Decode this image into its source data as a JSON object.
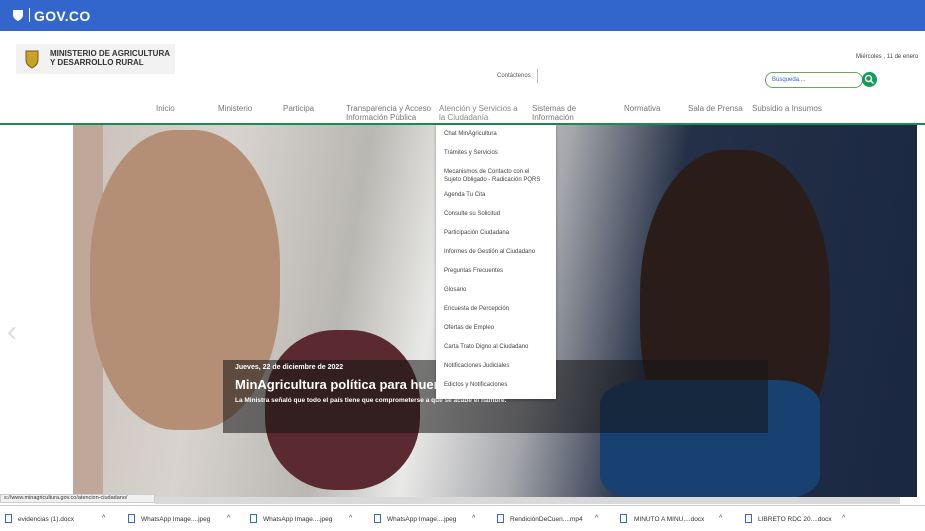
{
  "govbar": {
    "brand": "GOV.CO"
  },
  "header": {
    "ministry_line1": "MINISTERIO DE AGRICULTURA",
    "ministry_line2": "Y DESARROLLO RURAL",
    "date": "Miércoles , 11 de enero",
    "contact": "Contáctenos",
    "search_placeholder": "Búsqueda...."
  },
  "nav": [
    {
      "label": "Inicio"
    },
    {
      "label": "Ministerio"
    },
    {
      "label": "Participa"
    },
    {
      "label_1": "Transparencia y Acceso",
      "label_2": "Información Pública"
    },
    {
      "label_1": "Atención y Servicios a",
      "label_2": "la Ciudadanía"
    },
    {
      "label_1": "Sistemas de",
      "label_2": "Información"
    },
    {
      "label": "Normativa"
    },
    {
      "label": "Sala de Prensa"
    },
    {
      "label": "Subsidio a Insumos"
    }
  ],
  "dropdown": [
    "Chat MinAgricultura",
    "Trámites y Servicios",
    "Mecanismos de Contacto con el",
    "Sujeto Obligado - Radicación PQRS",
    "Agenda Tu Cita",
    "Consulte su Solicitud",
    "Participación Ciudadana",
    "Informes de Gestión al Ciudadano",
    "Preguntas Frecuentes",
    "Glosario",
    "Encuesta de Percepción",
    "Ofertas de Empleo",
    "Carta Trato Digno al Ciudadano",
    "Notificaciones Judiciales",
    "Edictos y Notificaciones"
  ],
  "caption": {
    "date": "Jueves, 22 de diciembre de 2022",
    "title": "MinAgricultura política para huert                              es comunitarios",
    "subtitle": "La Ministra señaló que todo el país tiene que comprometerse a que se acabe el hambre."
  },
  "status_url": "s://www.minagricultura.gov.co/atencion-ciudadano/",
  "downloads": [
    "evidencias (1).docx",
    "WhatsApp Image....jpeg",
    "WhatsApp Image....jpeg",
    "WhatsApp Image....jpeg",
    "RendiciónDeCuen....mp4",
    "MINUTO A MINU....docx",
    "LIBRETO RDC 20....docx"
  ],
  "colors": {
    "govbar": "#3366cc",
    "accent_green": "#1d8b4d"
  }
}
